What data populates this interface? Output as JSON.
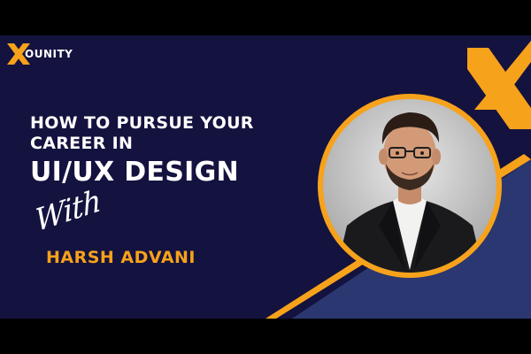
{
  "brand": {
    "name": "OUNITY",
    "logo_icon": "x-logo-icon"
  },
  "headline": {
    "line1": "HOW TO PURSUE YOUR",
    "line2": "CAREER IN",
    "line3": "UI/UX DESIGN"
  },
  "with_label": "With",
  "presenter": {
    "name": "HARSH ADVANI"
  },
  "colors": {
    "background": "#14123f",
    "accent": "#f7a21b",
    "panel": "#2a3770",
    "text": "#ffffff"
  }
}
